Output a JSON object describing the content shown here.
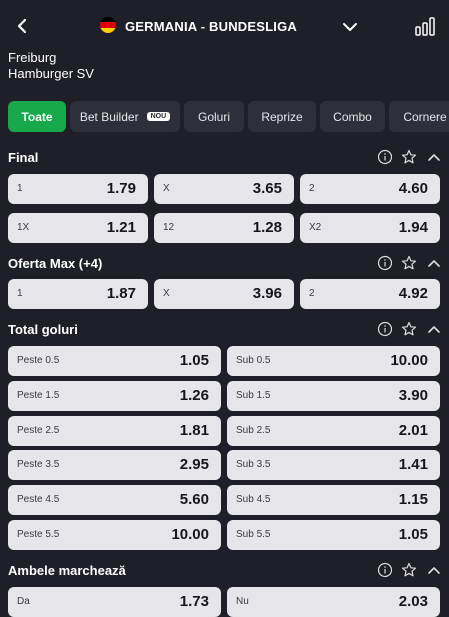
{
  "header": {
    "league": "GERMANIA - BUNDESLIGA"
  },
  "match": {
    "home": "Freiburg",
    "away": "Hamburger SV"
  },
  "tabs": [
    "Toate",
    "Bet Builder",
    "Goluri",
    "Reprize",
    "Combo",
    "Cornere"
  ],
  "badge": "NOU",
  "sections": {
    "final": {
      "title": "Final",
      "rows": [
        [
          [
            "1",
            "1.79"
          ],
          [
            "X",
            "3.65"
          ],
          [
            "2",
            "4.60"
          ]
        ],
        [
          [
            "1X",
            "1.21"
          ],
          [
            "12",
            "1.28"
          ],
          [
            "X2",
            "1.94"
          ]
        ]
      ]
    },
    "oferta": {
      "title": "Oferta Max (+4)",
      "rows": [
        [
          [
            "1",
            "1.87"
          ],
          [
            "X",
            "3.96"
          ],
          [
            "2",
            "4.92"
          ]
        ]
      ]
    },
    "total": {
      "title": "Total goluri",
      "rows": [
        [
          [
            "Peste 0.5",
            "1.05"
          ],
          [
            "Sub 0.5",
            "10.00"
          ]
        ],
        [
          [
            "Peste 1.5",
            "1.26"
          ],
          [
            "Sub 1.5",
            "3.90"
          ]
        ],
        [
          [
            "Peste 2.5",
            "1.81"
          ],
          [
            "Sub 2.5",
            "2.01"
          ]
        ],
        [
          [
            "Peste 3.5",
            "2.95"
          ],
          [
            "Sub 3.5",
            "1.41"
          ]
        ],
        [
          [
            "Peste 4.5",
            "5.60"
          ],
          [
            "Sub 4.5",
            "1.15"
          ]
        ],
        [
          [
            "Peste 5.5",
            "10.00"
          ],
          [
            "Sub 5.5",
            "1.05"
          ]
        ]
      ]
    },
    "ambele": {
      "title": "Ambele marchează",
      "rows": [
        [
          [
            "Da",
            "1.73"
          ],
          [
            "Nu",
            "2.03"
          ]
        ]
      ]
    }
  },
  "colors": {
    "background": "#1f1f2a",
    "accent": "#17a84a",
    "chip": "#2f2f3b",
    "odd_button": "#e5e5ea"
  }
}
